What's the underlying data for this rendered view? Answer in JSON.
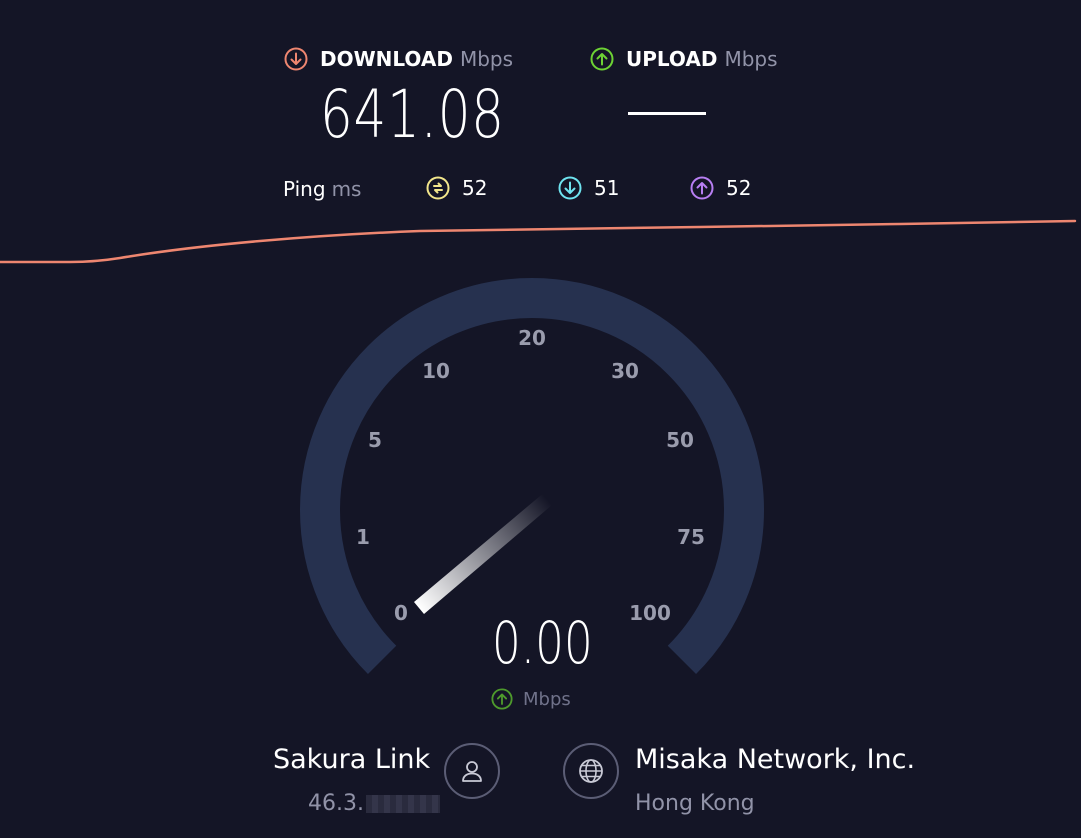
{
  "download": {
    "label": "DOWNLOAD",
    "unit": "Mbps",
    "value": "641.08",
    "icon": "download-icon",
    "color": "#ee8670"
  },
  "upload": {
    "label": "UPLOAD",
    "unit": "Mbps",
    "value": "—",
    "icon": "upload-icon",
    "color": "#6dd234"
  },
  "ping": {
    "label": "Ping",
    "unit": "ms",
    "idle": {
      "value": "52",
      "icon": "idle-ping-icon",
      "color": "#f2e68b"
    },
    "download": {
      "value": "51",
      "icon": "download-ping-icon",
      "color": "#6ee3ef"
    },
    "upload": {
      "value": "52",
      "icon": "upload-ping-icon",
      "color": "#b77ef2"
    }
  },
  "gauge": {
    "ticks": [
      "0",
      "1",
      "5",
      "10",
      "20",
      "30",
      "50",
      "75",
      "100"
    ],
    "value": "0.00",
    "unit": "Mbps",
    "unit_icon": "upload-icon",
    "needle_value": 0,
    "colors": {
      "track": "#26314f",
      "needle": "#ffffff"
    }
  },
  "client": {
    "isp": "Sakura Link",
    "ip": "46.3.",
    "icon": "user-icon"
  },
  "server": {
    "name": "Misaka Network, Inc.",
    "location": "Hong Kong",
    "icon": "globe-icon"
  },
  "graph": {
    "color": "#ee8670"
  }
}
